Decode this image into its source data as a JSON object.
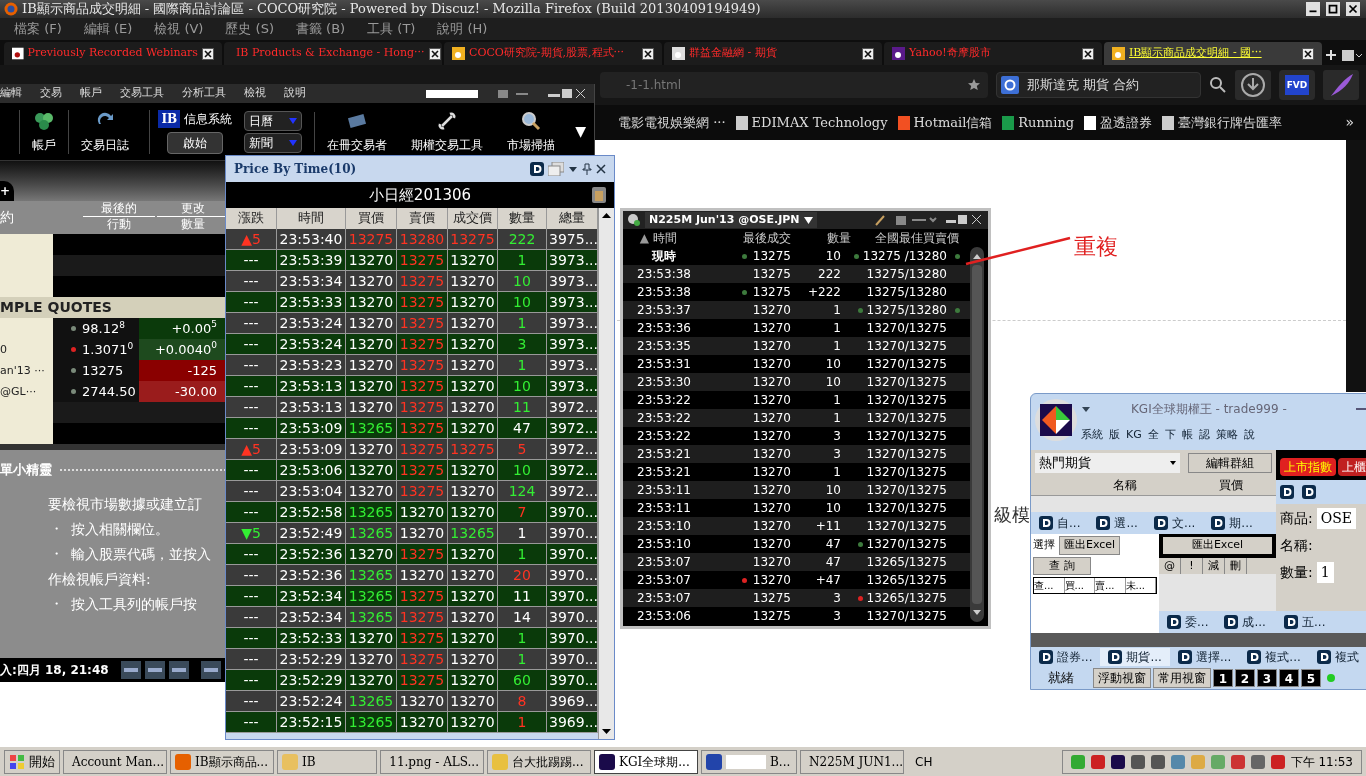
{
  "firefox": {
    "title": "IB顯示商品成交明細 - 國際商品討論區 - COCO研究院 - Powered by Discuz! - Mozilla Firefox (Build 20130409194949)",
    "menu": [
      "檔案 (F)",
      "編輯 (E)",
      "檢視 (V)",
      "歷史 (S)",
      "書籤 (B)",
      "工具 (T)",
      "說明 (H)"
    ],
    "tabs": [
      {
        "label": "Previously Recorded Webinars",
        "selected": false
      },
      {
        "label": "IB Products & Exchange - Hong···",
        "selected": false
      },
      {
        "label": "COCO研究院-期貨,股票,程式···",
        "selected": false
      },
      {
        "label": "群益金融網 - 期貨",
        "selected": false
      },
      {
        "label": "Yahoo!奇摩股市",
        "selected": false
      },
      {
        "label": "IB顯示商品成交明細 - 國···",
        "selected": true
      }
    ],
    "url": "-1-1.html",
    "search": "那斯達克 期貨 合約",
    "fvd": "FVD",
    "bookmarks": [
      "電影電視娛樂網 ···",
      "EDIMAX Technology",
      "Hotmail信箱",
      "Running",
      "盈透證券",
      "臺灣銀行牌告匯率"
    ],
    "bookmarks_more": "»"
  },
  "page": {
    "fragment": "級模"
  },
  "ib": {
    "menu": [
      "編輯",
      "交易",
      "帳戶",
      "交易工具",
      "分析工具",
      "檢視",
      "說明"
    ],
    "tools_left": [
      "帳戶",
      "交易日誌"
    ],
    "logo": "IB",
    "messages": "信息系統",
    "start": "啟始",
    "dropdowns": [
      "日曆",
      "新聞"
    ],
    "tools_right": [
      "在冊交易者",
      "期權交易工具",
      "市場掃描"
    ],
    "more": "▼",
    "new_tab": "+",
    "left_header": "約",
    "columns": [
      {
        "top": "最後的",
        "bottom": "行動"
      },
      {
        "top": "更改",
        "bottom": "數量"
      }
    ],
    "section": "MPLE QUOTES",
    "quotes": [
      {
        "dot": {
          "color": "#7a8a7a"
        },
        "price": "98.12$^{8}$",
        "change": {
          "text": "+0.00$^{5}$",
          "color": "#0b3a0b"
        }
      },
      {
        "label": "0",
        "dot": {
          "color": "#dd2222"
        },
        "price": "1.3071$^{0}$",
        "change": {
          "text": "+0.0040$^{0}$",
          "color": "#1e4a1e"
        }
      },
      {
        "label": "an'13 ···",
        "dot": {
          "color": "#7a8a7a"
        },
        "price": "13275",
        "change": {
          "text": "-125",
          "color": "#8a0000"
        }
      },
      {
        "label": "@GL···",
        "dot": {
          "color": "#7a8a7a"
        },
        "price": "2744.50",
        "change": {
          "text": "-30.00",
          "color": "#9a1c1c"
        }
      }
    ],
    "tips_title": "單小精靈",
    "tips": [
      {
        "kind": "text",
        "text": "要檢視市場數據或建立訂"
      },
      {
        "kind": "bullet",
        "text": "按入相關欄位。"
      },
      {
        "kind": "bullet",
        "text": "輸入股票代碼，並按入"
      },
      {
        "kind": "text",
        "text": "作檢視帳戶資料:"
      },
      {
        "kind": "bullet",
        "text": "按入工具列的帳戶按"
      }
    ],
    "bullet": "・",
    "status": "入:四月 18, 21:48"
  },
  "pbt": {
    "title": "Price By Time(10)",
    "product": "小日經201306",
    "columns": [
      "漲跌",
      "時間",
      "買價",
      "賣價",
      "成交價",
      "數量",
      "總量"
    ],
    "rows": [
      {
        "cells": [
          {
            "text": "▲5",
            "kind": "up"
          },
          {
            "text": "23:53:40",
            "kind": "flat"
          },
          {
            "text": "13275",
            "kind": "up"
          },
          {
            "text": "13280",
            "kind": "up"
          },
          {
            "text": "13275",
            "kind": "up"
          },
          {
            "text": "222",
            "kind": "down"
          },
          {
            "text": "3975...",
            "kind": "flat"
          }
        ]
      },
      {
        "cells": [
          {
            "text": "---",
            "kind": "flat"
          },
          {
            "text": "23:53:39",
            "kind": "flat"
          },
          {
            "text": "13270",
            "kind": "flat"
          },
          {
            "text": "13275",
            "kind": "up"
          },
          {
            "text": "13270",
            "kind": "flat"
          },
          {
            "text": "1",
            "kind": "down"
          },
          {
            "text": "3973...",
            "kind": "flat"
          }
        ]
      },
      {
        "cells": [
          {
            "text": "---",
            "kind": "flat"
          },
          {
            "text": "23:53:34",
            "kind": "flat"
          },
          {
            "text": "13270",
            "kind": "flat"
          },
          {
            "text": "13275",
            "kind": "up"
          },
          {
            "text": "13270",
            "kind": "flat"
          },
          {
            "text": "10",
            "kind": "down"
          },
          {
            "text": "3973...",
            "kind": "flat"
          }
        ]
      },
      {
        "cells": [
          {
            "text": "---",
            "kind": "flat"
          },
          {
            "text": "23:53:33",
            "kind": "flat"
          },
          {
            "text": "13270",
            "kind": "flat"
          },
          {
            "text": "13275",
            "kind": "up"
          },
          {
            "text": "13270",
            "kind": "flat"
          },
          {
            "text": "10",
            "kind": "down"
          },
          {
            "text": "3973...",
            "kind": "flat"
          }
        ]
      },
      {
        "cells": [
          {
            "text": "---",
            "kind": "flat"
          },
          {
            "text": "23:53:24",
            "kind": "flat"
          },
          {
            "text": "13270",
            "kind": "flat"
          },
          {
            "text": "13275",
            "kind": "up"
          },
          {
            "text": "13270",
            "kind": "flat"
          },
          {
            "text": "1",
            "kind": "down"
          },
          {
            "text": "3973...",
            "kind": "flat"
          }
        ]
      },
      {
        "cells": [
          {
            "text": "---",
            "kind": "flat"
          },
          {
            "text": "23:53:24",
            "kind": "flat"
          },
          {
            "text": "13270",
            "kind": "flat"
          },
          {
            "text": "13275",
            "kind": "up"
          },
          {
            "text": "13270",
            "kind": "flat"
          },
          {
            "text": "3",
            "kind": "down"
          },
          {
            "text": "3973...",
            "kind": "flat"
          }
        ]
      },
      {
        "cells": [
          {
            "text": "---",
            "kind": "flat"
          },
          {
            "text": "23:53:23",
            "kind": "flat"
          },
          {
            "text": "13270",
            "kind": "flat"
          },
          {
            "text": "13275",
            "kind": "up"
          },
          {
            "text": "13270",
            "kind": "flat"
          },
          {
            "text": "1",
            "kind": "down"
          },
          {
            "text": "3973...",
            "kind": "flat"
          }
        ]
      },
      {
        "cells": [
          {
            "text": "---",
            "kind": "flat"
          },
          {
            "text": "23:53:13",
            "kind": "flat"
          },
          {
            "text": "13270",
            "kind": "flat"
          },
          {
            "text": "13275",
            "kind": "up"
          },
          {
            "text": "13270",
            "kind": "flat"
          },
          {
            "text": "10",
            "kind": "down"
          },
          {
            "text": "3973...",
            "kind": "flat"
          }
        ]
      },
      {
        "cells": [
          {
            "text": "---",
            "kind": "flat"
          },
          {
            "text": "23:53:13",
            "kind": "flat"
          },
          {
            "text": "13270",
            "kind": "flat"
          },
          {
            "text": "13275",
            "kind": "up"
          },
          {
            "text": "13270",
            "kind": "flat"
          },
          {
            "text": "11",
            "kind": "down"
          },
          {
            "text": "3972...",
            "kind": "flat"
          }
        ]
      },
      {
        "cells": [
          {
            "text": "---",
            "kind": "flat"
          },
          {
            "text": "23:53:09",
            "kind": "flat"
          },
          {
            "text": "13265",
            "kind": "down"
          },
          {
            "text": "13275",
            "kind": "up"
          },
          {
            "text": "13270",
            "kind": "flat"
          },
          {
            "text": "47",
            "kind": "flat"
          },
          {
            "text": "3972...",
            "kind": "flat"
          }
        ]
      },
      {
        "cells": [
          {
            "text": "▲5",
            "kind": "up"
          },
          {
            "text": "23:53:09",
            "kind": "flat"
          },
          {
            "text": "13270",
            "kind": "flat"
          },
          {
            "text": "13275",
            "kind": "up"
          },
          {
            "text": "13275",
            "kind": "up"
          },
          {
            "text": "5",
            "kind": "up"
          },
          {
            "text": "3972...",
            "kind": "flat"
          }
        ]
      },
      {
        "cells": [
          {
            "text": "---",
            "kind": "flat"
          },
          {
            "text": "23:53:06",
            "kind": "flat"
          },
          {
            "text": "13270",
            "kind": "flat"
          },
          {
            "text": "13275",
            "kind": "up"
          },
          {
            "text": "13270",
            "kind": "flat"
          },
          {
            "text": "10",
            "kind": "down"
          },
          {
            "text": "3972...",
            "kind": "flat"
          }
        ]
      },
      {
        "cells": [
          {
            "text": "---",
            "kind": "flat"
          },
          {
            "text": "23:53:04",
            "kind": "flat"
          },
          {
            "text": "13270",
            "kind": "flat"
          },
          {
            "text": "13275",
            "kind": "up"
          },
          {
            "text": "13270",
            "kind": "flat"
          },
          {
            "text": "124",
            "kind": "down"
          },
          {
            "text": "3972...",
            "kind": "flat"
          }
        ]
      },
      {
        "cells": [
          {
            "text": "---",
            "kind": "flat"
          },
          {
            "text": "23:52:58",
            "kind": "flat"
          },
          {
            "text": "13265",
            "kind": "down"
          },
          {
            "text": "13270",
            "kind": "flat"
          },
          {
            "text": "13270",
            "kind": "flat"
          },
          {
            "text": "7",
            "kind": "up"
          },
          {
            "text": "3970...",
            "kind": "flat"
          }
        ]
      },
      {
        "cells": [
          {
            "text": "▼5",
            "kind": "down"
          },
          {
            "text": "23:52:49",
            "kind": "flat"
          },
          {
            "text": "13265",
            "kind": "down"
          },
          {
            "text": "13270",
            "kind": "flat"
          },
          {
            "text": "13265",
            "kind": "down"
          },
          {
            "text": "1",
            "kind": "flat"
          },
          {
            "text": "3970...",
            "kind": "flat"
          }
        ]
      },
      {
        "cells": [
          {
            "text": "---",
            "kind": "flat"
          },
          {
            "text": "23:52:36",
            "kind": "flat"
          },
          {
            "text": "13270",
            "kind": "flat"
          },
          {
            "text": "13275",
            "kind": "up"
          },
          {
            "text": "13270",
            "kind": "flat"
          },
          {
            "text": "1",
            "kind": "down"
          },
          {
            "text": "3970...",
            "kind": "flat"
          }
        ]
      },
      {
        "cells": [
          {
            "text": "---",
            "kind": "flat"
          },
          {
            "text": "23:52:36",
            "kind": "flat"
          },
          {
            "text": "13265",
            "kind": "down"
          },
          {
            "text": "13270",
            "kind": "flat"
          },
          {
            "text": "13270",
            "kind": "flat"
          },
          {
            "text": "20",
            "kind": "up"
          },
          {
            "text": "3970...",
            "kind": "flat"
          }
        ]
      },
      {
        "cells": [
          {
            "text": "---",
            "kind": "flat"
          },
          {
            "text": "23:52:34",
            "kind": "flat"
          },
          {
            "text": "13265",
            "kind": "down"
          },
          {
            "text": "13275",
            "kind": "up"
          },
          {
            "text": "13270",
            "kind": "flat"
          },
          {
            "text": "11",
            "kind": "flat"
          },
          {
            "text": "3970...",
            "kind": "flat"
          }
        ]
      },
      {
        "cells": [
          {
            "text": "---",
            "kind": "flat"
          },
          {
            "text": "23:52:34",
            "kind": "flat"
          },
          {
            "text": "13265",
            "kind": "down"
          },
          {
            "text": "13275",
            "kind": "up"
          },
          {
            "text": "13270",
            "kind": "flat"
          },
          {
            "text": "14",
            "kind": "flat"
          },
          {
            "text": "3970...",
            "kind": "flat"
          }
        ]
      },
      {
        "cells": [
          {
            "text": "---",
            "kind": "flat"
          },
          {
            "text": "23:52:33",
            "kind": "flat"
          },
          {
            "text": "13270",
            "kind": "flat"
          },
          {
            "text": "13275",
            "kind": "up"
          },
          {
            "text": "13270",
            "kind": "flat"
          },
          {
            "text": "1",
            "kind": "down"
          },
          {
            "text": "3970...",
            "kind": "flat"
          }
        ]
      },
      {
        "cells": [
          {
            "text": "---",
            "kind": "flat"
          },
          {
            "text": "23:52:29",
            "kind": "flat"
          },
          {
            "text": "13270",
            "kind": "flat"
          },
          {
            "text": "13275",
            "kind": "up"
          },
          {
            "text": "13270",
            "kind": "flat"
          },
          {
            "text": "1",
            "kind": "down"
          },
          {
            "text": "3970...",
            "kind": "flat"
          }
        ]
      },
      {
        "cells": [
          {
            "text": "---",
            "kind": "flat"
          },
          {
            "text": "23:52:29",
            "kind": "flat"
          },
          {
            "text": "13270",
            "kind": "flat"
          },
          {
            "text": "13275",
            "kind": "up"
          },
          {
            "text": "13270",
            "kind": "flat"
          },
          {
            "text": "60",
            "kind": "down"
          },
          {
            "text": "3970...",
            "kind": "flat"
          }
        ]
      },
      {
        "cells": [
          {
            "text": "---",
            "kind": "flat"
          },
          {
            "text": "23:52:24",
            "kind": "flat"
          },
          {
            "text": "13265",
            "kind": "down"
          },
          {
            "text": "13270",
            "kind": "flat"
          },
          {
            "text": "13270",
            "kind": "flat"
          },
          {
            "text": "8",
            "kind": "up"
          },
          {
            "text": "3969...",
            "kind": "flat"
          }
        ]
      },
      {
        "cells": [
          {
            "text": "---",
            "kind": "flat"
          },
          {
            "text": "23:52:15",
            "kind": "flat"
          },
          {
            "text": "13265",
            "kind": "down"
          },
          {
            "text": "13270",
            "kind": "flat"
          },
          {
            "text": "13270",
            "kind": "flat"
          },
          {
            "text": "1",
            "kind": "up"
          },
          {
            "text": "3969...",
            "kind": "flat"
          }
        ]
      }
    ]
  },
  "n225": {
    "title": "N225M Jun'13 @OSE.JPN",
    "sort_mark": "▲",
    "columns": [
      "時間",
      "最後成交",
      "數量",
      "全國最佳買賣價"
    ],
    "rows": [
      {
        "time": "現時",
        "last": "13275",
        "last_dot": {
          "color": "#3d7a3d"
        },
        "qty": "10",
        "bbo": "13275 /13280",
        "bbo_dot": {
          "color": "#3d7a3d"
        },
        "bbo_dot_right": {
          "color": "#3d7a3d"
        }
      },
      {
        "time": "23:53:38",
        "last": "13275",
        "qty": "222",
        "bbo": "13275/13280"
      },
      {
        "time": "23:53:38",
        "last": "13275",
        "last_dot": {
          "color": "#3d7a3d"
        },
        "qty": "+222",
        "bbo": "13275/13280"
      },
      {
        "time": "23:53:37",
        "last": "13270",
        "qty": "1",
        "bbo": "13275/13280",
        "bbo_dot": {
          "color": "#3d7a3d"
        },
        "bbo_dot_right": {
          "color": "#3d7a3d"
        }
      },
      {
        "time": "23:53:36",
        "last": "13270",
        "qty": "1",
        "bbo": "13270/13275"
      },
      {
        "time": "23:53:35",
        "last": "13270",
        "qty": "1",
        "bbo": "13270/13275"
      },
      {
        "time": "23:53:31",
        "last": "13270",
        "qty": "10",
        "bbo": "13270/13275"
      },
      {
        "time": "23:53:30",
        "last": "13270",
        "qty": "10",
        "bbo": "13270/13275"
      },
      {
        "time": "23:53:22",
        "last": "13270",
        "qty": "1",
        "bbo": "13270/13275"
      },
      {
        "time": "23:53:22",
        "last": "13270",
        "qty": "1",
        "bbo": "13270/13275"
      },
      {
        "time": "23:53:22",
        "last": "13270",
        "qty": "3",
        "bbo": "13270/13275"
      },
      {
        "time": "23:53:21",
        "last": "13270",
        "qty": "3",
        "bbo": "13270/13275"
      },
      {
        "time": "23:53:21",
        "last": "13270",
        "qty": "1",
        "bbo": "13270/13275"
      },
      {
        "time": "23:53:11",
        "last": "13270",
        "qty": "10",
        "bbo": "13270/13275"
      },
      {
        "time": "23:53:11",
        "last": "13270",
        "qty": "10",
        "bbo": "13270/13275"
      },
      {
        "time": "23:53:10",
        "last": "13270",
        "qty": "+11",
        "bbo": "13270/13275"
      },
      {
        "time": "23:53:10",
        "last": "13270",
        "qty": "47",
        "bbo": "13270/13275",
        "bbo_dot": {
          "color": "#3d7a3d"
        }
      },
      {
        "time": "23:53:07",
        "last": "13270",
        "qty": "47",
        "bbo": "13265/13275"
      },
      {
        "time": "23:53:07",
        "last": "13270",
        "last_dot": {
          "color": "#dd2222"
        },
        "qty": "+47",
        "bbo": "13265/13275"
      },
      {
        "time": "23:53:07",
        "last": "13275",
        "qty": "3",
        "bbo": "13265/13275",
        "bbo_dot": {
          "color": "#dd2222"
        }
      },
      {
        "time": "23:53:06",
        "last": "13275",
        "qty": "3",
        "bbo": "13270/13275"
      }
    ]
  },
  "annotation": {
    "text": "重複"
  },
  "kgi": {
    "title": "KGI全球期權王 - trade999 -",
    "menu": [
      "系統",
      "版",
      "KG",
      "全",
      "下",
      "帳",
      "認",
      "策略",
      "說"
    ],
    "group": "熱門期貨",
    "edit_group": "編輯群組",
    "name_col": "名稱",
    "bid_col": "買價",
    "tabs": [
      "自...",
      "選...",
      "文...",
      "期..."
    ],
    "select_label": "選擇",
    "export": "匯出Excel",
    "query": "查 詢",
    "order_cols": [
      "查...",
      "買...",
      "賣...",
      "未..."
    ],
    "export2": "匯出Excel",
    "fill_cols": [
      "@",
      "!",
      "減",
      "刪"
    ],
    "fill_tabs": [
      "委...",
      "成..."
    ],
    "index_tabs": [
      {
        "label": "上市指數",
        "selected": true
      },
      {
        "label": "上櫃",
        "selected": false
      }
    ],
    "product_label": "商品:",
    "product": "OSE",
    "name_label": "名稱:",
    "qty_label": "數量:",
    "qty": "1",
    "quote_tab": "五...",
    "bottom_tabs": [
      {
        "label": "證券...",
        "selected": false
      },
      {
        "label": "期貨...",
        "selected": true
      },
      {
        "label": "選擇...",
        "selected": false
      },
      {
        "label": "複式...",
        "selected": false
      },
      {
        "label": "複式",
        "selected": false
      }
    ],
    "status": "就緒",
    "float": "浮動視窗",
    "common": "常用視窗",
    "numbers": [
      "1",
      "2",
      "3",
      "4",
      "5"
    ]
  },
  "taskbar": {
    "start": "開始",
    "items": [
      {
        "label": "Account Man...",
        "selected": false
      },
      {
        "label": "IB顯示商品...",
        "selected": false
      },
      {
        "label": "IB",
        "selected": false
      },
      {
        "label": "11.png - ALS...",
        "selected": false
      },
      {
        "label": "台大批踢踢...",
        "selected": false
      },
      {
        "label": "KGI全球期...",
        "selected": true
      },
      {
        "label": "B...",
        "selected": false
      },
      {
        "label": "N225M JUN1...",
        "selected": false
      }
    ],
    "lang": "CH",
    "clock": "下午 11:53"
  }
}
